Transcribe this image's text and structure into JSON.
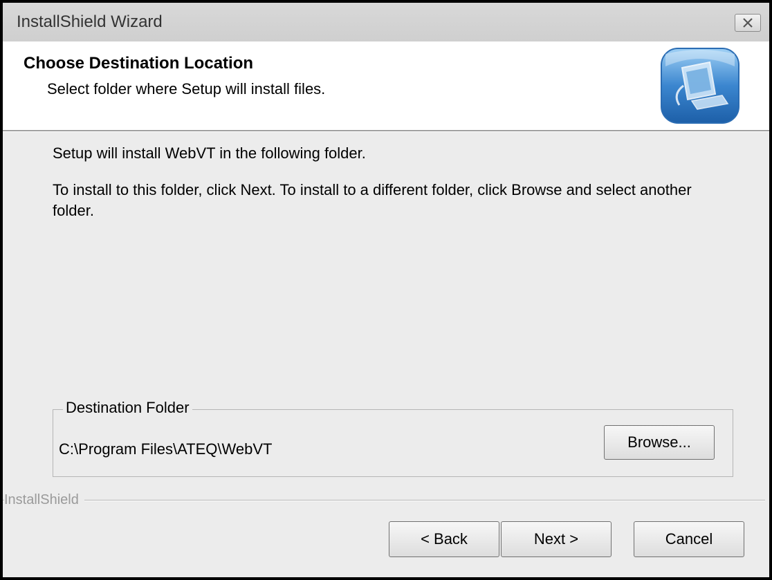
{
  "window": {
    "title": "InstallShield Wizard",
    "close_icon": "close-icon"
  },
  "header": {
    "title": "Choose Destination Location",
    "subtitle": "Select folder where Setup will install files.",
    "icon": "computer-install-icon"
  },
  "main": {
    "intro": "Setup will install WebVT in the following folder.",
    "instructions": "To install to this folder, click Next. To install to a different folder, click Browse and select another folder."
  },
  "destination": {
    "group_label": "Destination Folder",
    "path": "C:\\Program Files\\ATEQ\\WebVT",
    "browse_label": "Browse..."
  },
  "footer": {
    "brand": "InstallShield",
    "back_label": "< Back",
    "next_label": "Next >",
    "cancel_label": "Cancel"
  },
  "colors": {
    "dialog_bg": "#ececec",
    "header_bg": "#ffffff",
    "titlebar_bg": "#d3d3d3",
    "icon_blue": "#2f7cc6"
  }
}
